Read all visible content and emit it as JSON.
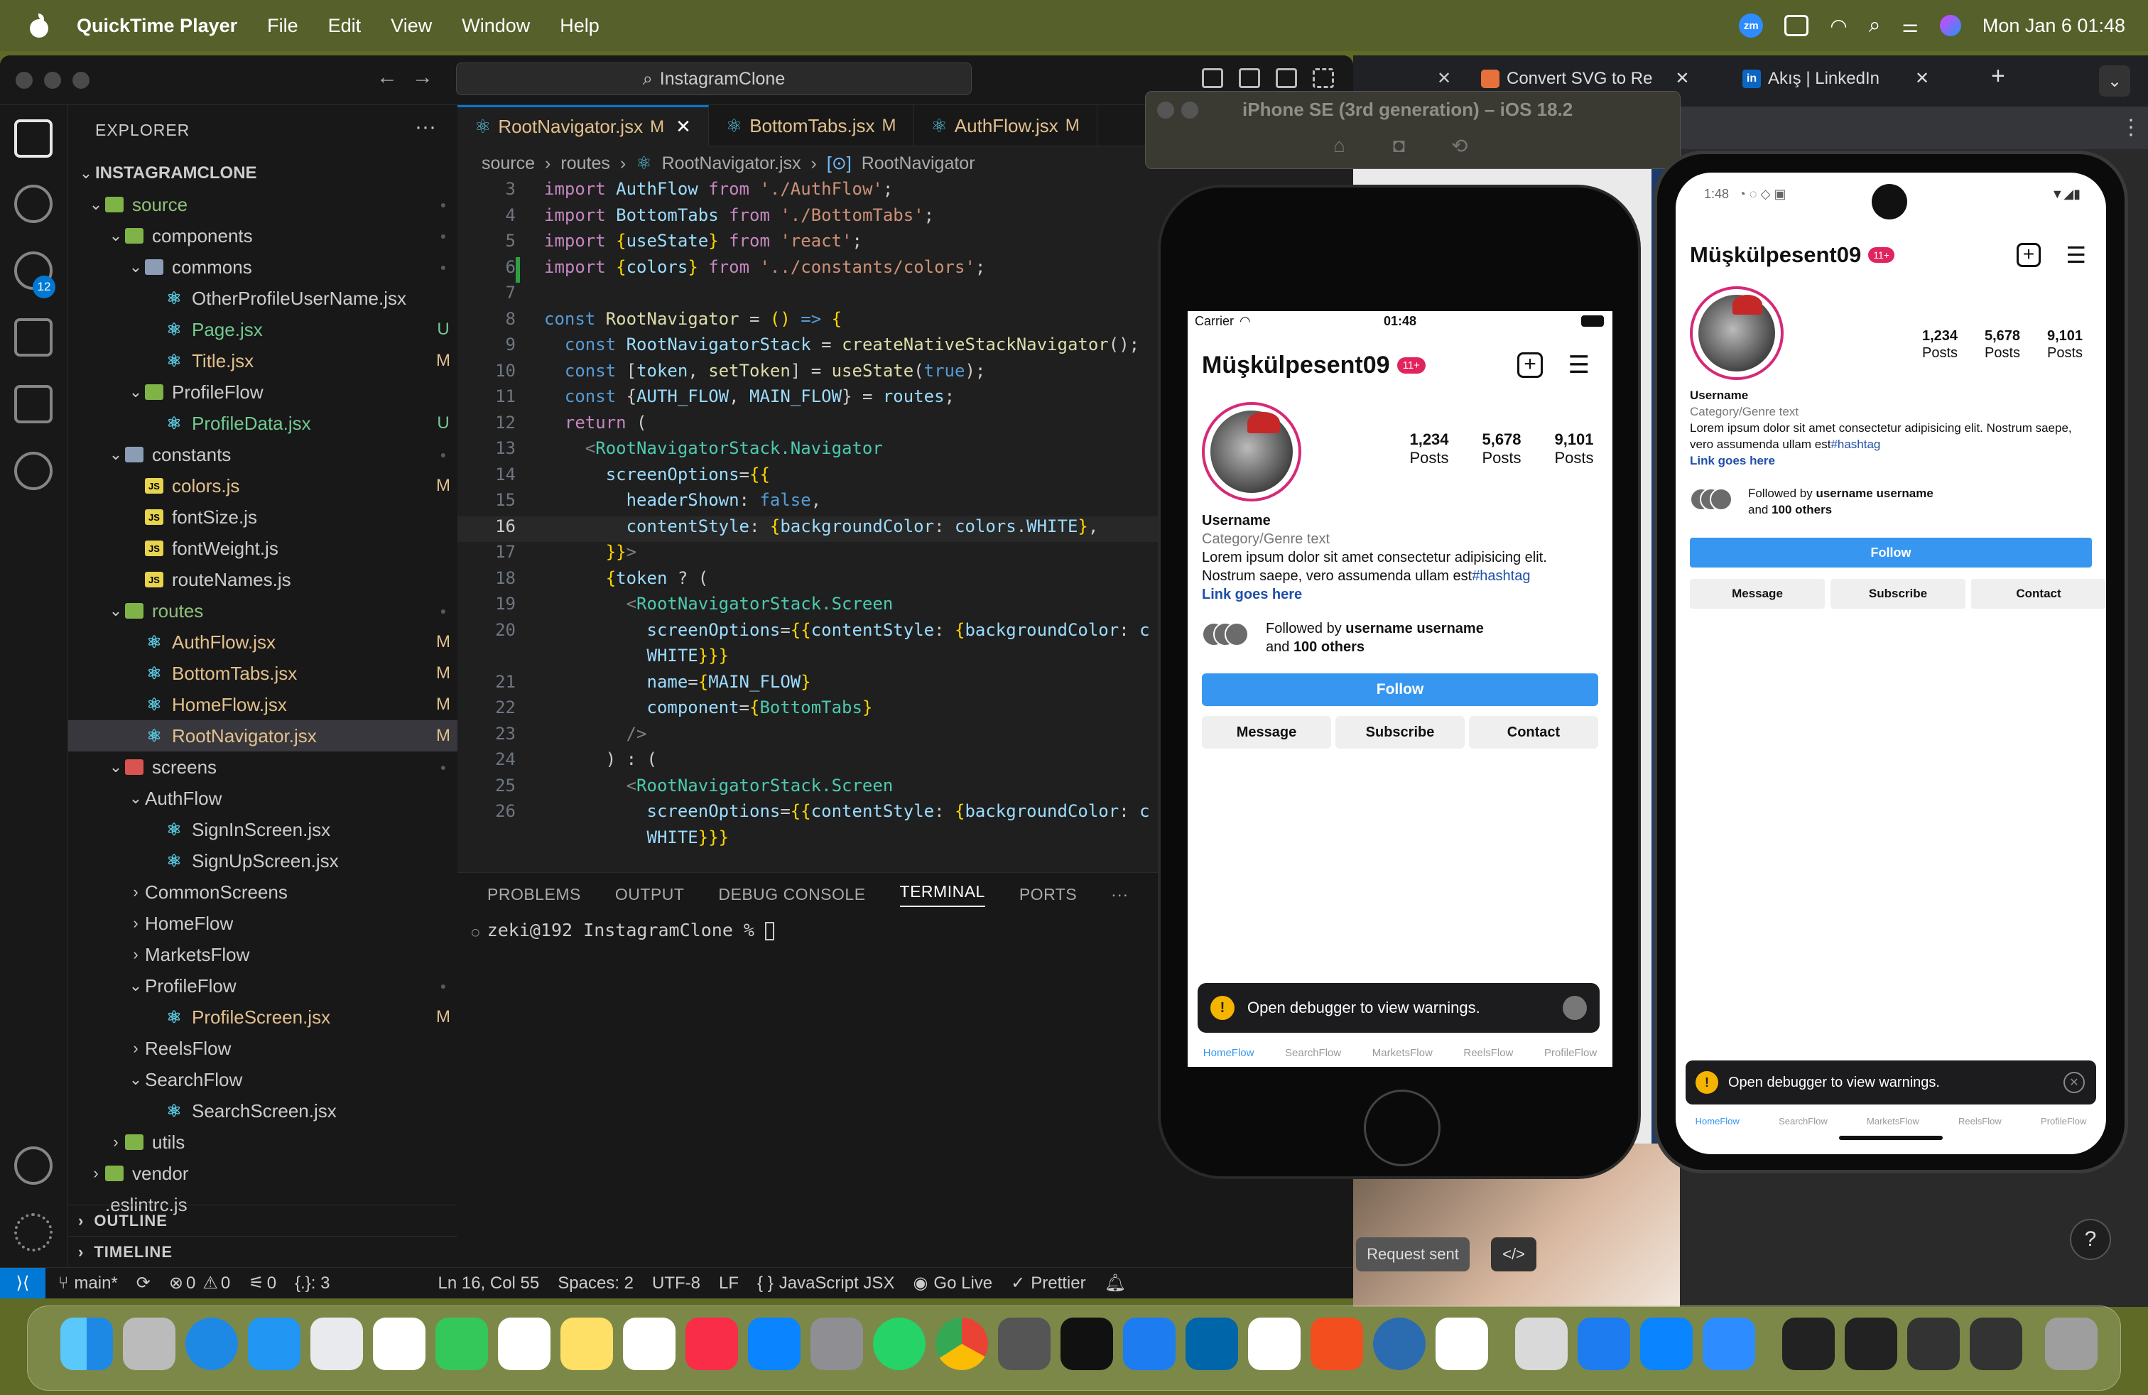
{
  "menubar": {
    "app": "QuickTime Player",
    "items": [
      "File",
      "Edit",
      "View",
      "Window",
      "Help"
    ],
    "zoom_badge": "zm",
    "datetime": "Mon Jan 6  01:48"
  },
  "vscode": {
    "search": "InstagramClone",
    "explorer_title": "EXPLORER",
    "project": "INSTAGRAMCLONE",
    "source_control_badge": "12",
    "tree": [
      {
        "label": "source",
        "depth": 1,
        "type": "folder-green",
        "open": true,
        "status": "dot"
      },
      {
        "label": "components",
        "depth": 2,
        "type": "folder",
        "open": true,
        "status": "dot"
      },
      {
        "label": "commons",
        "depth": 3,
        "type": "folder-blue",
        "open": true,
        "status": "dot"
      },
      {
        "label": "OtherProfileUserName.jsx",
        "depth": 4,
        "type": "jsx",
        "status": ""
      },
      {
        "label": "Page.jsx",
        "depth": 4,
        "type": "jsx",
        "status": "U"
      },
      {
        "label": "Title.jsx",
        "depth": 4,
        "type": "jsx",
        "status": "M"
      },
      {
        "label": "ProfileFlow",
        "depth": 3,
        "type": "folder",
        "open": true,
        "status": ""
      },
      {
        "label": "ProfileData.jsx",
        "depth": 4,
        "type": "jsx",
        "status": "U"
      },
      {
        "label": "constants",
        "depth": 2,
        "type": "folder-blue",
        "open": true,
        "status": "dot"
      },
      {
        "label": "colors.js",
        "depth": 3,
        "type": "js",
        "status": "M"
      },
      {
        "label": "fontSize.js",
        "depth": 3,
        "type": "js",
        "status": ""
      },
      {
        "label": "fontWeight.js",
        "depth": 3,
        "type": "js",
        "status": ""
      },
      {
        "label": "routeNames.js",
        "depth": 3,
        "type": "js",
        "status": ""
      },
      {
        "label": "routes",
        "depth": 2,
        "type": "folder-green",
        "open": true,
        "status": "dot"
      },
      {
        "label": "AuthFlow.jsx",
        "depth": 3,
        "type": "jsx",
        "status": "M"
      },
      {
        "label": "BottomTabs.jsx",
        "depth": 3,
        "type": "jsx",
        "status": "M"
      },
      {
        "label": "HomeFlow.jsx",
        "depth": 3,
        "type": "jsx",
        "status": "M"
      },
      {
        "label": "RootNavigator.jsx",
        "depth": 3,
        "type": "jsx",
        "status": "M",
        "selected": true
      },
      {
        "label": "screens",
        "depth": 2,
        "type": "folder-red",
        "open": true,
        "status": "dot"
      },
      {
        "label": "AuthFlow",
        "depth": 3,
        "type": "plain",
        "open": true,
        "status": ""
      },
      {
        "label": "SignInScreen.jsx",
        "depth": 4,
        "type": "jsx",
        "status": ""
      },
      {
        "label": "SignUpScreen.jsx",
        "depth": 4,
        "type": "jsx",
        "status": ""
      },
      {
        "label": "CommonScreens",
        "depth": 3,
        "type": "plain",
        "open": false,
        "status": ""
      },
      {
        "label": "HomeFlow",
        "depth": 3,
        "type": "plain",
        "open": false,
        "status": ""
      },
      {
        "label": "MarketsFlow",
        "depth": 3,
        "type": "plain",
        "open": false,
        "status": ""
      },
      {
        "label": "ProfileFlow",
        "depth": 3,
        "type": "plain",
        "open": true,
        "status": "dot"
      },
      {
        "label": "ProfileScreen.jsx",
        "depth": 4,
        "type": "jsx",
        "status": "M"
      },
      {
        "label": "ReelsFlow",
        "depth": 3,
        "type": "plain",
        "open": false,
        "status": ""
      },
      {
        "label": "SearchFlow",
        "depth": 3,
        "type": "plain",
        "open": true,
        "status": ""
      },
      {
        "label": "SearchScreen.jsx",
        "depth": 4,
        "type": "jsx",
        "status": ""
      },
      {
        "label": "utils",
        "depth": 2,
        "type": "folder",
        "open": false,
        "status": ""
      },
      {
        "label": "vendor",
        "depth": 1,
        "type": "folder",
        "open": false,
        "status": ""
      },
      {
        "label": ".eslintrc.js",
        "depth": 1,
        "type": "plain-file",
        "status": ""
      }
    ],
    "outline": "OUTLINE",
    "timeline": "TIMELINE",
    "tabs": [
      {
        "label": "RootNavigator.jsx",
        "mark": "M",
        "active": true
      },
      {
        "label": "BottomTabs.jsx",
        "mark": "M",
        "active": false
      },
      {
        "label": "AuthFlow.jsx",
        "mark": "M",
        "active": false
      }
    ],
    "breadcrumbs": [
      "source",
      "routes",
      "RootNavigator.jsx",
      "RootNavigator"
    ],
    "panel_tabs": [
      "PROBLEMS",
      "OUTPUT",
      "DEBUG CONSOLE",
      "TERMINAL",
      "PORTS"
    ],
    "terminal_prompt": "zeki@192 InstagramClone % ",
    "status": {
      "branch": "main*",
      "errors": "0",
      "warnings": "0",
      "ports": "0",
      "brackets": "{.}: 3",
      "position": "Ln 16, Col 55",
      "spaces": "Spaces: 2",
      "encoding": "UTF-8",
      "eol": "LF",
      "language": "JavaScript JSX",
      "golive": "Go Live",
      "prettier": "Prettier"
    }
  },
  "chrome": {
    "tabs": [
      "Convert SVG to Re",
      "Akış | LinkedIn"
    ],
    "request_sent": "Request sent"
  },
  "simulator": {
    "title": "iPhone SE (3rd generation) – iOS 18.2"
  },
  "profile": {
    "username": "Müşkülpesent09",
    "badge": "11+",
    "stats": [
      {
        "value": "1,234",
        "label": "Posts"
      },
      {
        "value": "5,678",
        "label": "Posts"
      },
      {
        "value": "9,101",
        "label": "Posts"
      }
    ],
    "display_name": "Username",
    "category": "Category/Genre text",
    "bio": "Lorem ipsum dolor sit amet consectetur adipisicing elit. Nostrum saepe, vero assumenda ullam est",
    "hashtag": "#hashtag",
    "link": "Link goes here",
    "followed_prefix": "Followed by ",
    "followed_names": "username username",
    "followed_and": "and ",
    "followed_count": "100 others",
    "follow_btn": "Follow",
    "message_btn": "Message",
    "subscribe_btn": "Subscribe",
    "contact_btn": "Contact",
    "warning": "Open debugger to view warnings.",
    "nav": [
      "HomeFlow",
      "SearchFlow",
      "MarketsFlow",
      "ReelsFlow",
      "ProfileFlow"
    ]
  },
  "ios_status": {
    "carrier": "Carrier",
    "time": "01:48"
  },
  "android_status": {
    "time": "1:48"
  }
}
